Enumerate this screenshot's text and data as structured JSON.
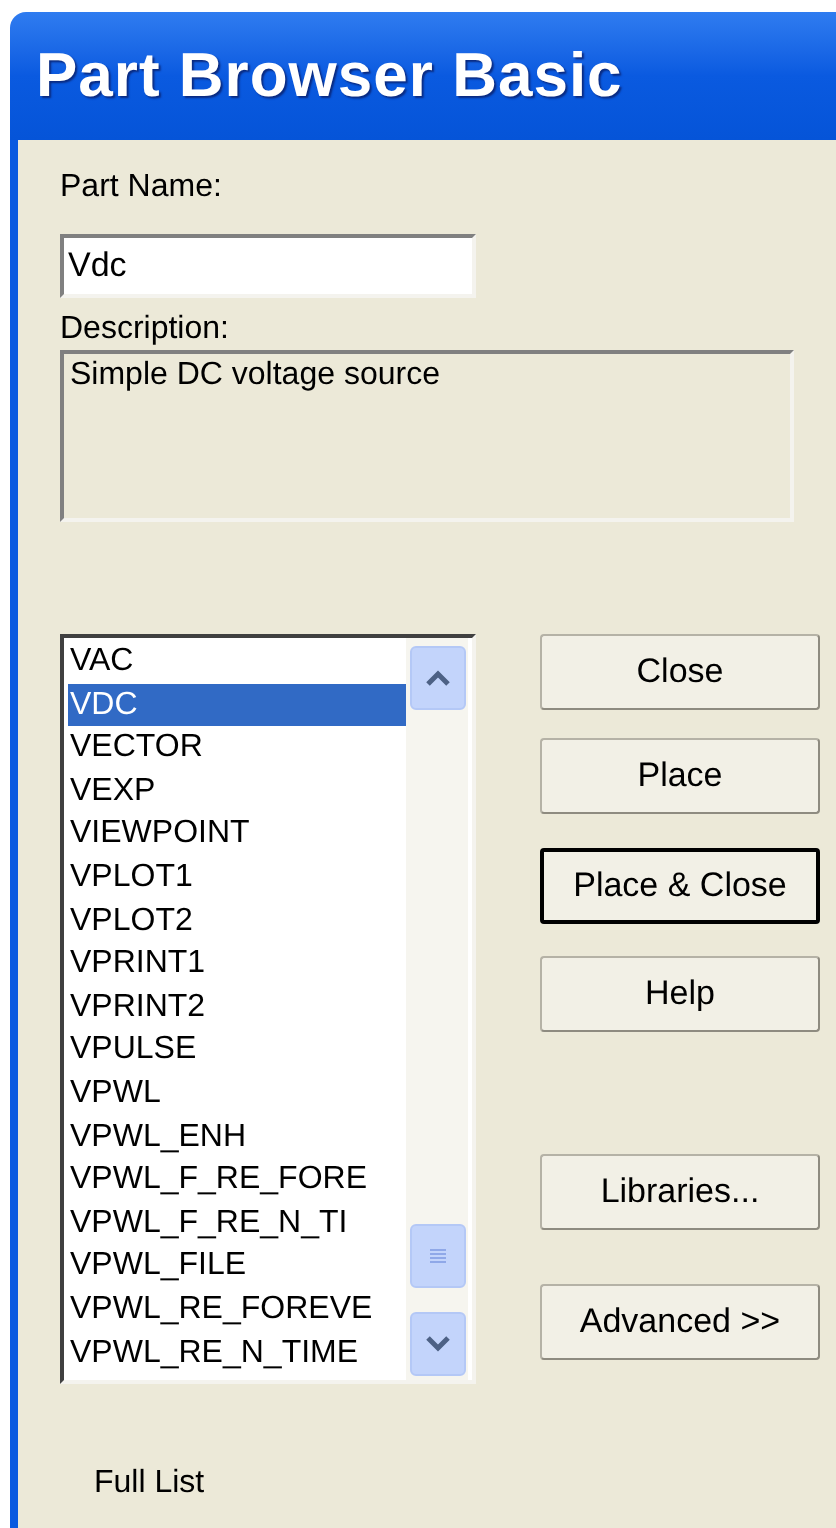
{
  "window": {
    "title": "Part Browser Basic"
  },
  "part_name": {
    "label": "Part Name:",
    "value": "Vdc"
  },
  "description": {
    "label": "Description:",
    "value": "Simple DC voltage source"
  },
  "parts_list": {
    "items": [
      {
        "label": "VAC",
        "selected": false
      },
      {
        "label": "VDC",
        "selected": true
      },
      {
        "label": "VECTOR",
        "selected": false
      },
      {
        "label": "VEXP",
        "selected": false
      },
      {
        "label": "VIEWPOINT",
        "selected": false
      },
      {
        "label": "VPLOT1",
        "selected": false
      },
      {
        "label": "VPLOT2",
        "selected": false
      },
      {
        "label": "VPRINT1",
        "selected": false
      },
      {
        "label": "VPRINT2",
        "selected": false
      },
      {
        "label": "VPULSE",
        "selected": false
      },
      {
        "label": "VPWL",
        "selected": false
      },
      {
        "label": "VPWL_ENH",
        "selected": false
      },
      {
        "label": "VPWL_F_RE_FORE",
        "selected": false
      },
      {
        "label": "VPWL_F_RE_N_TI",
        "selected": false
      },
      {
        "label": "VPWL_FILE",
        "selected": false
      },
      {
        "label": "VPWL_RE_FOREVE",
        "selected": false
      },
      {
        "label": "VPWL_RE_N_TIME",
        "selected": false
      }
    ]
  },
  "buttons": [
    {
      "label": "Close",
      "default": false
    },
    {
      "label": "Place",
      "default": false
    },
    {
      "label": "Place & Close",
      "default": true
    },
    {
      "label": "Help",
      "default": false
    },
    {
      "label": "Libraries...",
      "default": false
    },
    {
      "label": "Advanced >>",
      "default": false
    }
  ],
  "status": "Full List"
}
